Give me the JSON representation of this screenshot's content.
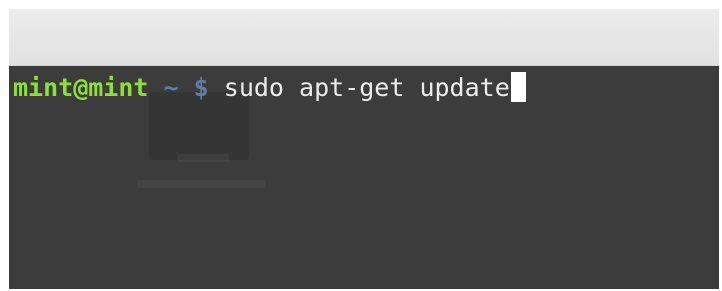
{
  "terminal": {
    "user_host": "mint@mint",
    "cwd": "~",
    "prompt_symbol": "$",
    "command": "sudo apt-get update"
  }
}
